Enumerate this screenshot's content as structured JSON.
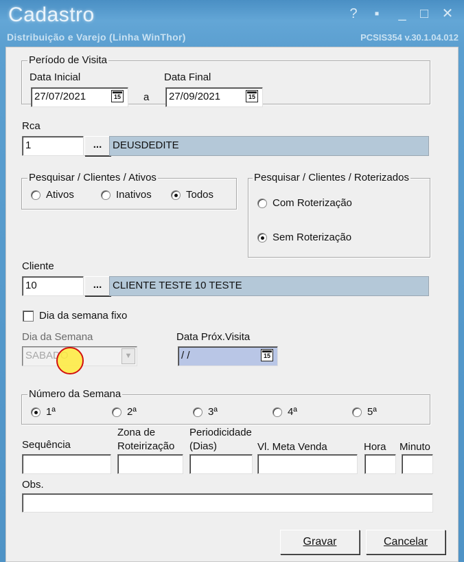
{
  "window": {
    "title": "Cadastro",
    "subtitle": "Distribuição e Varejo (Linha WinThor)",
    "version": "PCSIS354  v.30.1.04.012",
    "controls": [
      "?",
      "▪",
      "_",
      "□",
      "✕"
    ]
  },
  "periodo": {
    "legend": "Período de Visita",
    "data_inicial_label": "Data Inicial",
    "data_inicial_value": "27/07/2021",
    "a_label": "a",
    "data_final_label": "Data Final",
    "data_final_value": "27/09/2021",
    "cal_glyph": "15"
  },
  "rca": {
    "label": "Rca",
    "code": "1",
    "dots": "...",
    "name": "DEUSDEDITE"
  },
  "pesquisar_ativos": {
    "legend": "Pesquisar / Clientes / Ativos",
    "options": [
      {
        "label": "Ativos",
        "selected": false
      },
      {
        "label": "Inativos",
        "selected": false
      },
      {
        "label": "Todos",
        "selected": true
      }
    ]
  },
  "pesquisar_roterizados": {
    "legend": "Pesquisar / Clientes / Roterizados",
    "options": [
      {
        "label": "Com Roterização",
        "selected": false
      },
      {
        "label": "Sem Roterização",
        "selected": true
      }
    ]
  },
  "cliente": {
    "label": "Cliente",
    "code": "10",
    "dots": "...",
    "name": "CLIENTE TESTE  10 TESTE"
  },
  "dia_fixo": {
    "label": "Dia da semana fixo",
    "checked": false
  },
  "dia_semana": {
    "label": "Dia da Semana",
    "value": "SABADO",
    "arrow": "▼"
  },
  "data_prox": {
    "label": "Data Próx.Visita",
    "value": " /  /",
    "cal_glyph": "15"
  },
  "numero_semana": {
    "legend": "Número da Semana",
    "options": [
      {
        "label": "1ª",
        "selected": true
      },
      {
        "label": "2ª",
        "selected": false
      },
      {
        "label": "3ª",
        "selected": false
      },
      {
        "label": "4ª",
        "selected": false
      },
      {
        "label": "5ª",
        "selected": false
      }
    ]
  },
  "bottom_fields": {
    "sequencia": "Sequência",
    "zona_line1": "Zona de",
    "zona_line2": "Roteirização",
    "periodicidade_line1": "Periodicidade",
    "periodicidade_line2": "(Dias)",
    "meta": "Vl. Meta Venda",
    "hora": "Hora",
    "minuto": "Minuto",
    "obs": "Obs."
  },
  "buttons": {
    "gravar": "Gravar",
    "cancelar": "Cancelar"
  },
  "colors": {
    "titlebar": "#5b9fd0",
    "readonly_field": "#b4c8d8",
    "date_field_lavender": "#b9c6e6",
    "cursor_ring": "#d21010",
    "cursor_fill": "#ffeb3c"
  }
}
